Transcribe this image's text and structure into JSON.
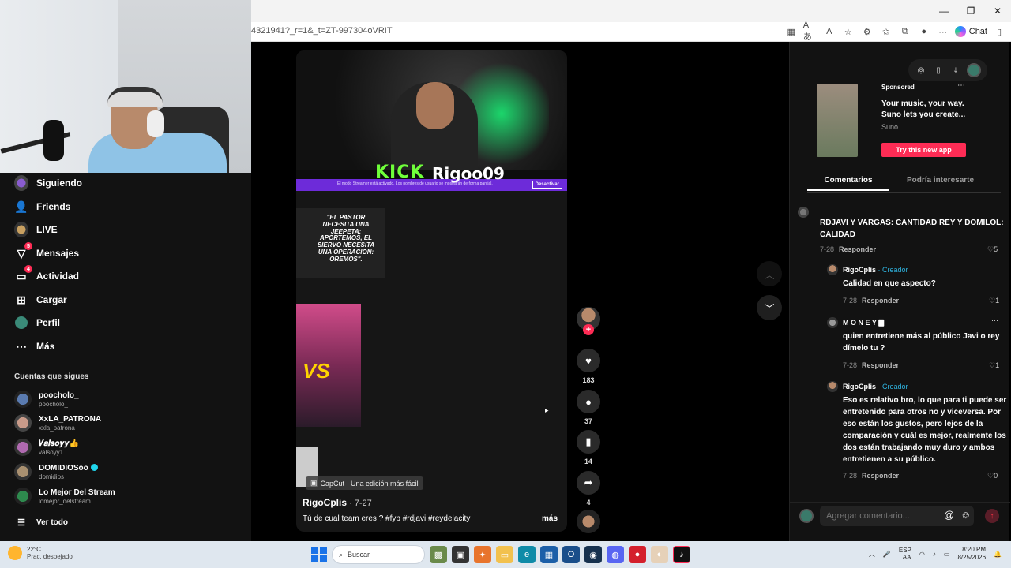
{
  "browser": {
    "url": "4321941?_r=1&_t=ZT-997304oVRIT",
    "chat_label": "Chat",
    "window_controls": [
      "minimize-icon",
      "restore-icon",
      "close-icon"
    ]
  },
  "sidebar": {
    "items": [
      {
        "label": "Siguiendo",
        "icon": "following-avatar-icon"
      },
      {
        "label": "Friends",
        "icon": "friends-icon"
      },
      {
        "label": "LIVE",
        "icon": "live-icon"
      },
      {
        "label": "Mensajes",
        "icon": "messages-icon",
        "badge": "5"
      },
      {
        "label": "Actividad",
        "icon": "activity-icon",
        "badge": "4"
      },
      {
        "label": "Cargar",
        "icon": "upload-icon"
      },
      {
        "label": "Perfil",
        "icon": "profile-icon"
      },
      {
        "label": "Más",
        "icon": "more-icon"
      }
    ],
    "following_title": "Cuentas que sigues",
    "accounts": [
      {
        "name": "poocholo_",
        "handle": "poocholo_"
      },
      {
        "name": "XxLA_PATRONA",
        "handle": "xxla_patrona"
      },
      {
        "name": "𝑽𝒂𝒍𝒔𝒐𝒚𝒚👍",
        "handle": "valsoyy1"
      },
      {
        "name": "DOMIDIOSoo",
        "handle": "domidios",
        "verified": true
      },
      {
        "name": "Lo Mejor Del Stream",
        "handle": "lomejor_delstream"
      }
    ],
    "see_all": "Ver todo"
  },
  "video": {
    "kick_text": "KICK",
    "kick_name": "Rigoo09",
    "banner_text": "El modo Streamer está activado. Los nombres de usuario se mostrarán de forma parcial.",
    "banner_button": "Desactivar",
    "post_text": "\"EL PASTOR NECESITA UNA JEEPETA: APORTEMOS, EL SIERVO NECESITA UNA OPERACION: OREMOS\".",
    "vs_text": "VS",
    "capcut_label": "CapCut · Una edición más fácil",
    "author": "RigoCplis",
    "date": " · 7-27",
    "caption": "Tú de cual team eres ? #fyp #rdjavi #reydelacity",
    "more": "más"
  },
  "actions": {
    "likes": "183",
    "comments": "37",
    "saves": "14",
    "shares": "4"
  },
  "panel": {
    "ad": {
      "sponsored": "Sponsored",
      "text": "Your music, your way. Suno lets you create...",
      "brand": "Suno",
      "button": "Try this new app"
    },
    "tabs": [
      "Comentarios",
      "Podría interesarte"
    ],
    "comments": [
      {
        "author": "",
        "text": "RDJAVI Y VARGAS: CANTIDAD REY Y DOMILOL: CALIDAD",
        "date": "7-28",
        "reply": "Responder",
        "likes": "5"
      },
      {
        "author": "RigoCplis",
        "creator": "· Creador",
        "text": "Calidad en que aspecto?",
        "date": "7-28",
        "reply": "Responder",
        "likes": "1"
      },
      {
        "author": "M O N E Y 🀫",
        "creator": "",
        "text": "quien entretiene más al público Javi o rey dímelo tu ?",
        "date": "7-28",
        "reply": "Responder",
        "likes": "1"
      },
      {
        "author": "RigoCplis",
        "creator": "· Creador",
        "text": "Eso es relativo bro, lo que para ti puede ser entretenido para otros no y viceversa. Por eso están los gustos, pero lejos de la comparación y cuál es mejor, realmente los dos están trabajando muy duro y ambos entretienen a su público.",
        "date": "7-28",
        "reply": "Responder",
        "likes": "0"
      }
    ],
    "comment_placeholder": "Agregar comentario..."
  },
  "taskbar": {
    "temp": "22°C",
    "weather": "Prac. despejado",
    "search": "Buscar",
    "lang1": "ESP",
    "lang2": "LAA",
    "time": "8:20 PM",
    "date": "8/25/2026"
  }
}
